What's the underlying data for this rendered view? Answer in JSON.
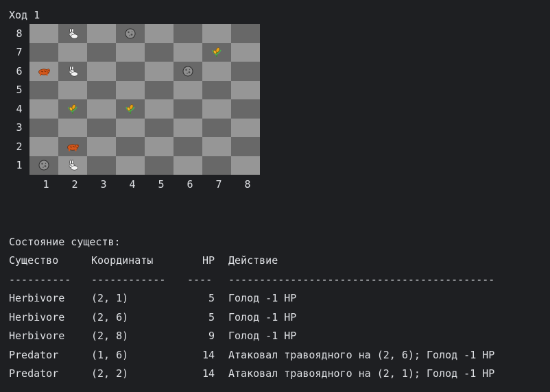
{
  "turn_label": "Ход 1",
  "ranks": [
    "8",
    "7",
    "6",
    "5",
    "4",
    "3",
    "2",
    "1"
  ],
  "files": [
    "1",
    "2",
    "3",
    "4",
    "5",
    "6",
    "7",
    "8"
  ],
  "pieces": [
    {
      "col": 2,
      "row": 8,
      "icon": "rabbit-icon"
    },
    {
      "col": 4,
      "row": 8,
      "icon": "rock-icon"
    },
    {
      "col": 7,
      "row": 7,
      "icon": "grass-icon"
    },
    {
      "col": 1,
      "row": 6,
      "icon": "bear-icon"
    },
    {
      "col": 2,
      "row": 6,
      "icon": "rabbit-icon"
    },
    {
      "col": 6,
      "row": 6,
      "icon": "rock-icon"
    },
    {
      "col": 2,
      "row": 4,
      "icon": "grass-icon"
    },
    {
      "col": 4,
      "row": 4,
      "icon": "grass-icon"
    },
    {
      "col": 2,
      "row": 2,
      "icon": "bear-icon"
    },
    {
      "col": 1,
      "row": 1,
      "icon": "rock-icon"
    },
    {
      "col": 2,
      "row": 1,
      "icon": "rabbit-icon"
    }
  ],
  "colors": {
    "background": "#1e1f22",
    "text": "#dfe1e5",
    "light_square": "#969696",
    "dark_square": "#686868"
  },
  "status_title": "Состояние существ:",
  "table": {
    "headers": {
      "name": "Существо",
      "coords": "Координаты",
      "hp": "HP",
      "action": "Действие"
    },
    "separators": {
      "name": "----------",
      "coords": "------------",
      "hp": "----",
      "action": "-------------------------------------------"
    },
    "rows": [
      {
        "name": "Herbivore",
        "coords": "(2, 1)",
        "hp": "5",
        "action": "Голод -1 HP"
      },
      {
        "name": "Herbivore",
        "coords": "(2, 6)",
        "hp": "5",
        "action": "Голод -1 HP"
      },
      {
        "name": "Herbivore",
        "coords": "(2, 8)",
        "hp": "9",
        "action": "Голод -1 HP"
      },
      {
        "name": "Predator",
        "coords": "(1, 6)",
        "hp": "14",
        "action": "Атаковал травоядного на (2, 6); Голод -1 HP"
      },
      {
        "name": "Predator",
        "coords": "(2, 2)",
        "hp": "14",
        "action": "Атаковал травоядного на (2, 1); Голод -1 HP"
      }
    ]
  }
}
